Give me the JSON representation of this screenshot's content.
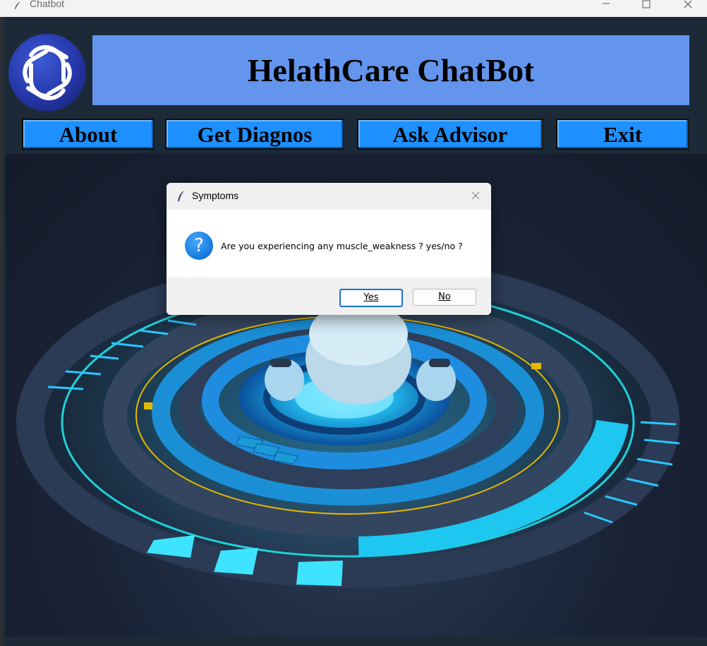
{
  "window": {
    "title": "Chatbot"
  },
  "header": {
    "title": "HelathCare ChatBot"
  },
  "nav": [
    {
      "label": "About"
    },
    {
      "label": "Get Diagnos"
    },
    {
      "label": "Ask Advisor"
    },
    {
      "label": "Exit"
    }
  ],
  "dialog": {
    "title": "Symptoms",
    "message": "Are you experiencing any muscle_weakness ? yes/no ?",
    "yes_label": "Yes",
    "no_label": "No",
    "icon": "question-icon"
  },
  "colors": {
    "banner": "#6495ed",
    "nav_button": "#1e90ff",
    "app_background": "#1b2a36"
  }
}
